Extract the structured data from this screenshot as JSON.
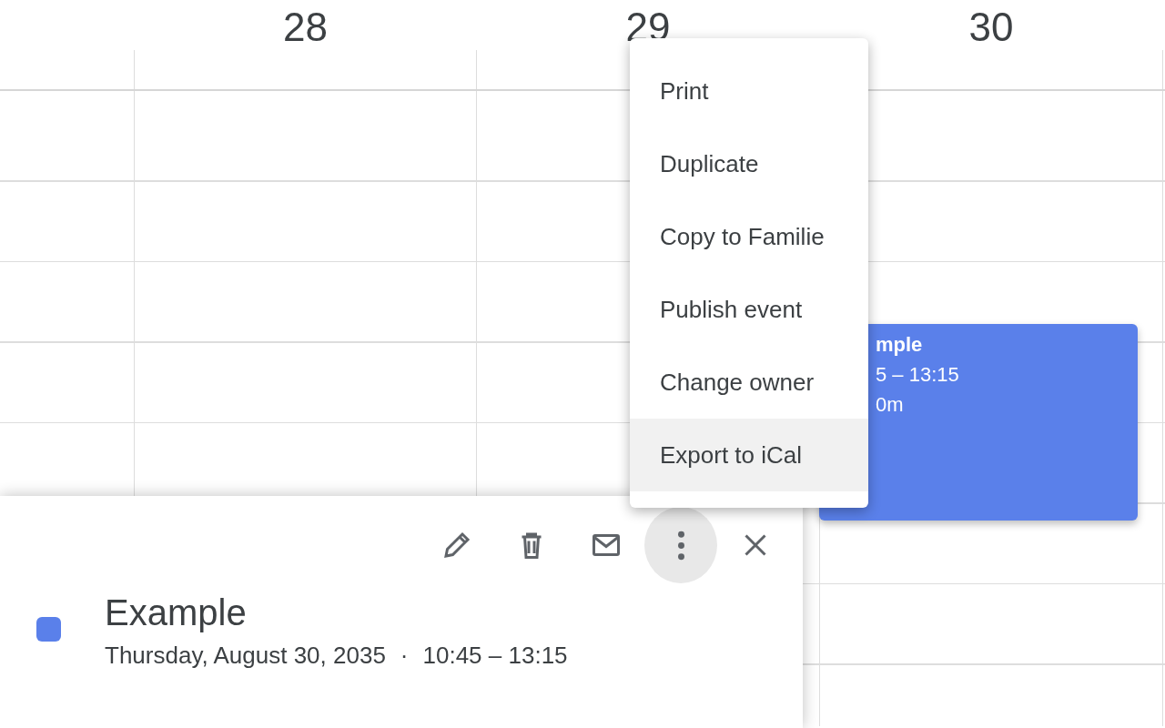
{
  "days": [
    {
      "label": "28"
    },
    {
      "label": "29"
    },
    {
      "label": "30"
    }
  ],
  "event_block": {
    "color": "#5a80ea",
    "lines": [
      "mple",
      "5 – 13:15",
      "0m"
    ]
  },
  "menu": {
    "items": [
      {
        "label": "Print",
        "highlighted": false
      },
      {
        "label": "Duplicate",
        "highlighted": false
      },
      {
        "label": "Copy to Familie",
        "highlighted": false
      },
      {
        "label": "Publish event",
        "highlighted": false
      },
      {
        "label": "Change owner",
        "highlighted": false
      },
      {
        "label": "Export to iCal",
        "highlighted": true
      }
    ]
  },
  "event_popup": {
    "toolbar": [
      {
        "kind": "edit",
        "active": false
      },
      {
        "kind": "delete",
        "active": false
      },
      {
        "kind": "email",
        "active": false
      },
      {
        "kind": "more",
        "active": true
      },
      {
        "kind": "close",
        "active": false
      }
    ],
    "color": "#5a80ea",
    "title": "Example",
    "date": "Thursday, August 30, 2035",
    "separator": "·",
    "time": "10:45 – 13:15"
  }
}
